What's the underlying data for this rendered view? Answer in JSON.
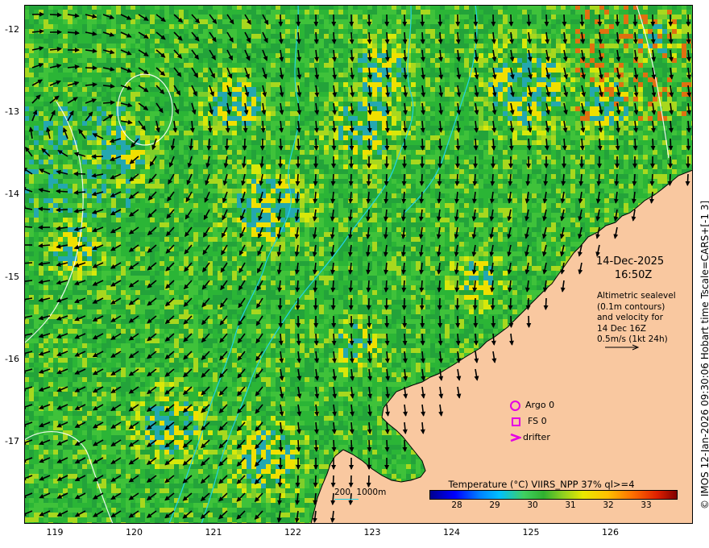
{
  "datetime": {
    "date": "14-Dec-2025",
    "time": "16:50Z"
  },
  "altimetry": {
    "lines": [
      "Altimetric sealevel",
      "(0.1m contours)",
      "and velocity for",
      "14 Dec 16Z",
      "0.5m/s (1kt 24h)"
    ]
  },
  "legend": {
    "argo": "Argo 0",
    "fs": "FS 0",
    "drifter": "drifter"
  },
  "bathy": {
    "label_200": "200",
    "label_1000": "1000m"
  },
  "colorbar": {
    "title": "Temperature (°C) VIIRS_NPP 37% ql>=4",
    "ticks": [
      "28",
      "29",
      "30",
      "31",
      "32",
      "33"
    ]
  },
  "axes": {
    "x_ticks": [
      "119",
      "120",
      "121",
      "122",
      "123",
      "124",
      "125",
      "126"
    ],
    "y_ticks": [
      "-12",
      "-13",
      "-14",
      "-15",
      "-16",
      "-17"
    ]
  },
  "credit": "© IMOS 12-Jan-2026 09:30:06 Hobart time Tscale=CARS+[-1 3]",
  "colors": {
    "land": "#f9c8a0",
    "contour_bathy": "#22d3e6",
    "sealevel_contour": "#ffffff",
    "marker": "#e400e4",
    "arrow": "#000000"
  }
}
